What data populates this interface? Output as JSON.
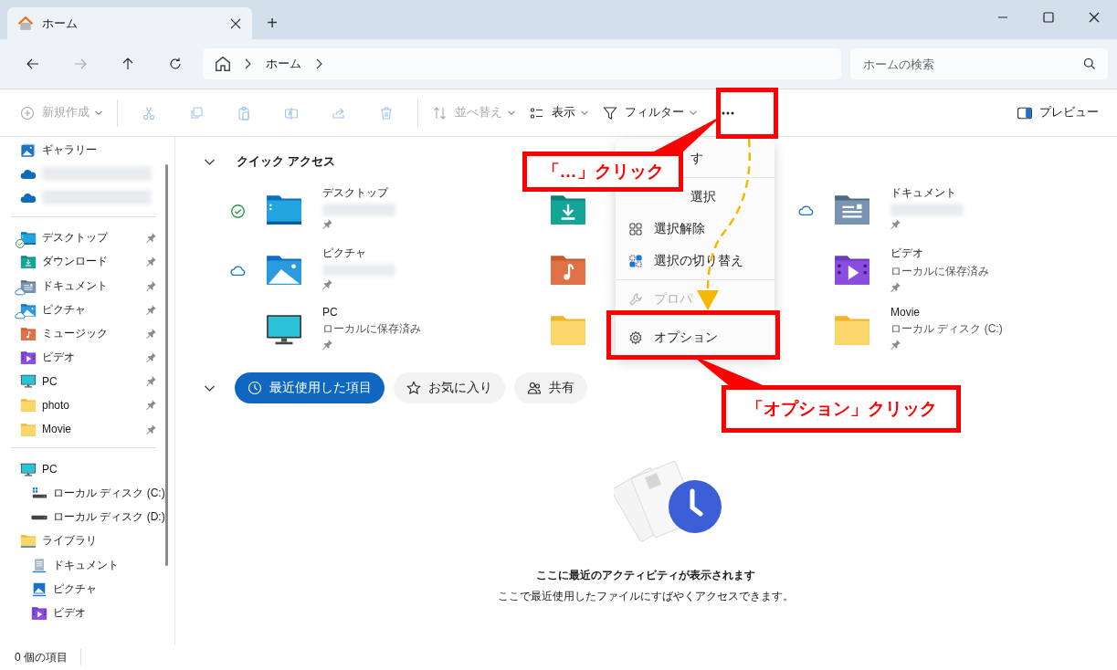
{
  "window": {
    "tabs": [
      {
        "title": "ホーム",
        "selected": true
      }
    ],
    "new_tab": "+"
  },
  "nav": [
    {
      "disabled": false
    },
    {
      "disabled": true
    },
    {
      "disabled": false
    },
    {
      "disabled": false
    }
  ],
  "address": {
    "crumbs": [
      "ホーム"
    ]
  },
  "search": {
    "placeholder": "ホームの検索"
  },
  "toolbar": {
    "items": [
      {
        "kind": "button",
        "label": "新規作成",
        "disabled": true,
        "dropdown": true
      },
      {
        "kind": "separator"
      },
      {
        "kind": "icon",
        "disabled": true
      },
      {
        "kind": "icon",
        "disabled": true
      },
      {
        "kind": "icon",
        "disabled": true
      },
      {
        "kind": "icon",
        "disabled": true
      },
      {
        "kind": "icon",
        "disabled": true
      },
      {
        "kind": "icon",
        "disabled": true
      },
      {
        "kind": "separator"
      },
      {
        "kind": "button",
        "label": "並べ替え",
        "disabled": true,
        "dropdown": true
      },
      {
        "kind": "button",
        "label": "表示",
        "disabled": false,
        "dropdown": true
      },
      {
        "kind": "button",
        "label": "フィルター",
        "disabled": false,
        "dropdown": true
      },
      {
        "kind": "icon",
        "disabled": false
      }
    ],
    "preview": {
      "label": "プレビュー"
    }
  },
  "sidebar": {
    "sections": [
      {
        "items": [
          {
            "kind": "gallery",
            "label": "ギャラリー"
          },
          {
            "kind": "onedrive"
          },
          {
            "kind": "onedrive"
          }
        ]
      },
      {
        "items": [
          {
            "kind": "desktop",
            "label": "デスクトップ",
            "pinned": true,
            "synced": true
          },
          {
            "kind": "download",
            "label": "ダウンロード",
            "pinned": true
          },
          {
            "kind": "documents",
            "label": "ドキュメント",
            "pinned": true,
            "online_only": true
          },
          {
            "kind": "pictures",
            "label": "ピクチャ",
            "pinned": true,
            "online_only": true
          },
          {
            "kind": "music",
            "label": "ミュージック",
            "pinned": true
          },
          {
            "kind": "videos",
            "label": "ビデオ",
            "pinned": true
          },
          {
            "kind": "pc",
            "label": "PC",
            "pinned": true
          },
          {
            "kind": "folder",
            "label": "photo",
            "pinned": true
          },
          {
            "kind": "folder",
            "label": "Movie",
            "pinned": true
          }
        ]
      },
      {
        "items": [
          {
            "kind": "pc",
            "label": "PC",
            "children": [
              {
                "kind": "drive-c",
                "label": "ローカル ディスク (C:)"
              },
              {
                "kind": "drive",
                "label": "ローカル ディスク (D:)"
              }
            ]
          },
          {
            "kind": "library",
            "label": "ライブラリ",
            "children": [
              {
                "kind": "doc-lib",
                "label": "ドキュメント"
              },
              {
                "kind": "pic-lib",
                "label": "ピクチャ"
              },
              {
                "kind": "videos",
                "label": "ビデオ"
              }
            ]
          }
        ]
      }
    ]
  },
  "quick_access": {
    "title": "クイック アクセス",
    "expanded": true,
    "items": [
      {
        "kind": "desktop",
        "name": "デスクトップ",
        "synced": true,
        "pinned": true
      },
      {
        "kind": "download"
      },
      {
        "kind": "documents",
        "name": "ドキュメント",
        "online_only": true,
        "pinned": true
      },
      {
        "kind": "pictures",
        "name": "ピクチャ",
        "online_only": true,
        "pinned": true
      },
      {
        "kind": "music"
      },
      {
        "kind": "videos",
        "name": "ビデオ",
        "subtitle": "ローカルに保存済み",
        "pinned": true
      },
      {
        "kind": "pc",
        "name": "PC",
        "subtitle": "ローカルに保存済み",
        "pinned": true
      },
      {
        "kind": "folder"
      },
      {
        "kind": "folder",
        "name": "Movie",
        "subtitle": "ローカル ディスク (C:)",
        "pinned": true
      }
    ]
  },
  "recent": {
    "expanded": true,
    "chips": [
      {
        "label": "最近使用した項目",
        "selected": true
      },
      {
        "label": "お気に入り",
        "selected": false
      },
      {
        "label": "共有",
        "selected": false
      }
    ],
    "empty_title": "ここに最近のアクティビティが表示されます",
    "empty_text": "ここで最近使用したファイルにすばやくアクセスできます。"
  },
  "menu": {
    "items": [
      {
        "kind": "item",
        "label": "す",
        "disabled": false
      },
      {
        "kind": "separator"
      },
      {
        "kind": "item",
        "label": "選択",
        "disabled": false
      },
      {
        "kind": "item",
        "label": "選択解除",
        "disabled": false
      },
      {
        "kind": "item",
        "label": "選択の切り替え",
        "disabled": false
      },
      {
        "kind": "separator"
      },
      {
        "kind": "item",
        "label": "プロパ",
        "disabled": true
      },
      {
        "kind": "item",
        "label": "オプション",
        "disabled": false
      }
    ]
  },
  "status_bar": {
    "text": "0 個の項目"
  },
  "annotations": [
    {
      "text": "「…」クリック"
    },
    {
      "text": "「オプション」クリック"
    }
  ]
}
